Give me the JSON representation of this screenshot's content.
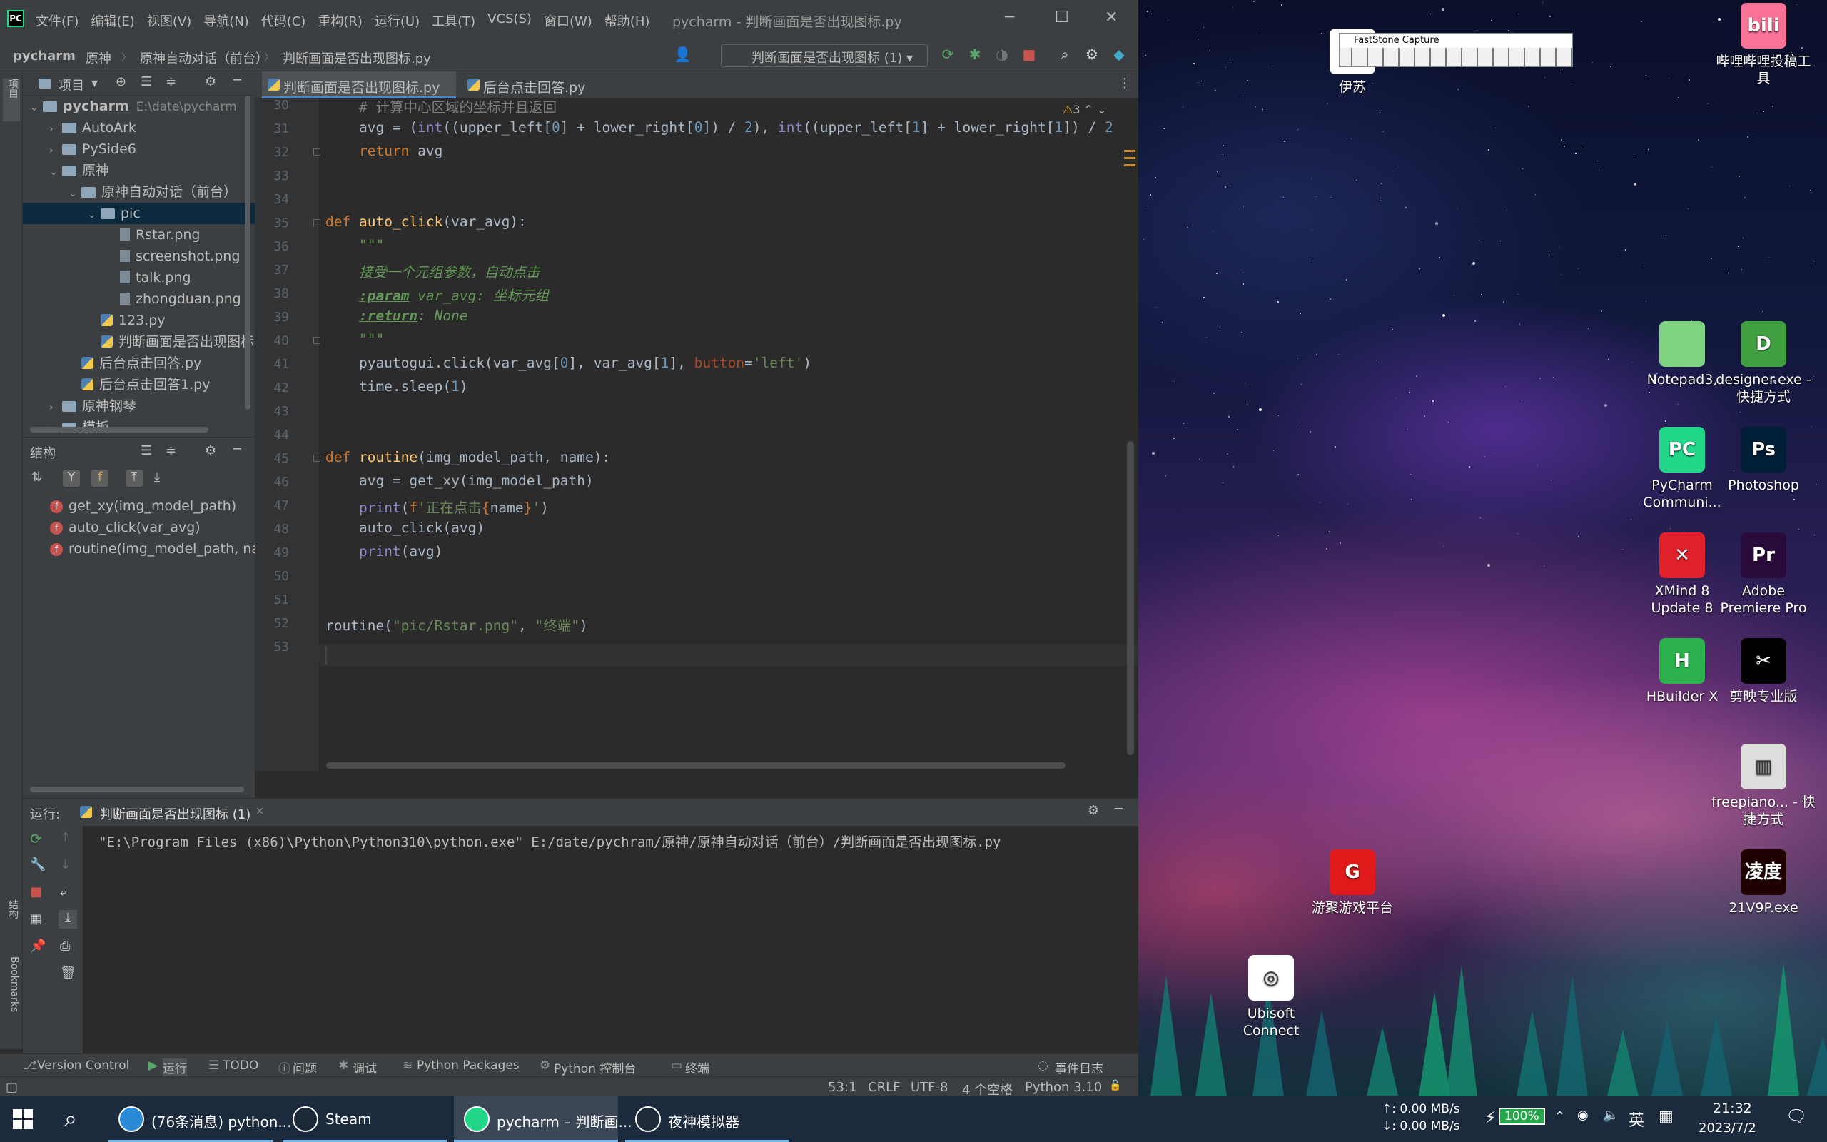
{
  "ide": {
    "menu": [
      "文件(F)",
      "编辑(E)",
      "视图(V)",
      "导航(N)",
      "代码(C)",
      "重构(R)",
      "运行(U)",
      "工具(T)",
      "VCS(S)",
      "窗口(W)",
      "帮助(H)"
    ],
    "window_title": "pycharm - 判断画面是否出现图标.py",
    "breadcrumbs": [
      "pycharm",
      "原神",
      "原神自动对话（前台）",
      "判断画面是否出现图标.py"
    ],
    "run_config": "判断画面是否出现图标 (1)",
    "project_label": "项目",
    "tree": [
      {
        "label": "pycharm",
        "extra": "E:\\date\\pycharm",
        "type": "folder",
        "depth": 0,
        "arrow": "down"
      },
      {
        "label": "AutoArk",
        "type": "folder",
        "depth": 1,
        "arrow": "right"
      },
      {
        "label": "PySide6",
        "type": "folder",
        "depth": 1,
        "arrow": "right"
      },
      {
        "label": "原神",
        "type": "folder",
        "depth": 1,
        "arrow": "down"
      },
      {
        "label": "原神自动对话（前台）",
        "type": "folder",
        "depth": 2,
        "arrow": "down"
      },
      {
        "label": "pic",
        "type": "folder",
        "depth": 3,
        "arrow": "down",
        "selected": true
      },
      {
        "label": "Rstar.png",
        "type": "png",
        "depth": 4
      },
      {
        "label": "screenshot.png",
        "type": "png",
        "depth": 4
      },
      {
        "label": "talk.png",
        "type": "png",
        "depth": 4
      },
      {
        "label": "zhongduan.png",
        "type": "png",
        "depth": 4
      },
      {
        "label": "123.py",
        "type": "py",
        "depth": 3
      },
      {
        "label": "判断画面是否出现图标",
        "type": "py",
        "depth": 3
      },
      {
        "label": "后台点击回答.py",
        "type": "py",
        "depth": 2
      },
      {
        "label": "后台点击回答1.py",
        "type": "py",
        "depth": 2
      },
      {
        "label": "原神钢琴",
        "type": "folder",
        "depth": 1,
        "arrow": "right"
      },
      {
        "label": "模板",
        "type": "folder",
        "depth": 1,
        "arrow": "right"
      }
    ],
    "structure_label": "结构",
    "structure_items": [
      "get_xy(img_model_path)",
      "auto_click(var_avg)",
      "routine(img_model_path, nam"
    ],
    "tabs": [
      "判断画面是否出现图标.py",
      "后台点击回答.py"
    ],
    "warnings": "3",
    "code_lines": [
      {
        "n": "30",
        "html": "    <span class='cmt'># 计算中心区域的坐标并且返回</span>"
      },
      {
        "n": "31",
        "html": "    avg = (<span class='bi'>int</span>((upper_left[<span class='num'>0</span>] + lower_right[<span class='num'>0</span>]) / <span class='num'>2</span>), <span class='bi'>int</span>((upper_left[<span class='num'>1</span>] + lower_right[<span class='num'>1</span>]) / <span class='num'>2</span>"
      },
      {
        "n": "32",
        "html": "    <span class='kw'>return</span> avg"
      },
      {
        "n": "33",
        "html": ""
      },
      {
        "n": "34",
        "html": ""
      },
      {
        "n": "35",
        "html": "<span class='kw'>def</span> <span class='fnc'>auto_click</span>(var_avg):"
      },
      {
        "n": "36",
        "html": "    <span class='doc'>\"\"\"</span>"
      },
      {
        "n": "37",
        "html": "    <span class='doc'>接受一个元组参数，自动点击</span>"
      },
      {
        "n": "38",
        "html": "    <span class='doc'><b><u>:param</u></b> var_avg: 坐标元组</span>"
      },
      {
        "n": "39",
        "html": "    <span class='doc'><b><u>:return</u></b>: None</span>"
      },
      {
        "n": "40",
        "html": "    <span class='doc'>\"\"\"</span>"
      },
      {
        "n": "41",
        "html": "    pyautogui.click(var_avg[<span class='num'>0</span>], var_avg[<span class='num'>1</span>], <span class='par'>button</span>=<span class='str'>'left'</span>)"
      },
      {
        "n": "42",
        "html": "    time.sleep(<span class='num'>1</span>)"
      },
      {
        "n": "43",
        "html": ""
      },
      {
        "n": "44",
        "html": ""
      },
      {
        "n": "45",
        "html": "<span class='kw'>def</span> <span class='fnc'>routine</span>(img_model_path, name):"
      },
      {
        "n": "46",
        "html": "    avg = get_xy(img_model_path)"
      },
      {
        "n": "47",
        "html": "    <span class='bi'>print</span>(<span class='kw'>f</span><span class='str'>'正在点击</span><span class='kw'>{</span>name<span class='kw'>}</span><span class='str'>'</span>)"
      },
      {
        "n": "48",
        "html": "    auto_click(avg)"
      },
      {
        "n": "49",
        "html": "    <span class='bi'>print</span>(avg)"
      },
      {
        "n": "50",
        "html": ""
      },
      {
        "n": "51",
        "html": ""
      },
      {
        "n": "52",
        "html": "routine(<span class='str'>\"pic/Rstar.png\"</span>, <span class='str'>\"终端\"</span>)"
      },
      {
        "n": "53",
        "html": ""
      }
    ],
    "run_label": "运行:",
    "run_tab": "判断画面是否出现图标 (1)",
    "console_line": "\"E:\\Program Files (x86)\\Python\\Python310\\python.exe\" E:/date/pychram/原神/原神自动对话（前台）/判断画面是否出现图标.py",
    "bottom_tools": [
      "Version Control",
      "运行",
      "TODO",
      "问题",
      "调试",
      "Python Packages",
      "Python 控制台",
      "终端"
    ],
    "event_log": "事件日志",
    "status": [
      "53:1",
      "CRLF",
      "UTF-8",
      "4 个空格",
      "Python 3.10"
    ],
    "side_labels": [
      "项目",
      "结构",
      "Bookmarks"
    ]
  },
  "fastcapture": {
    "title": "FastStone Capture"
  },
  "desktop_icons": [
    {
      "label": "哔哩哔哩投稿工具",
      "color": "#fb7299",
      "glyph": "bili"
    },
    {
      "label": "Notepad3,",
      "color": "#7fd27f",
      "glyph": ""
    },
    {
      "label": "designer.exe - 快捷方式",
      "color": "#40a040",
      "glyph": "D"
    },
    {
      "label": "PyCharm Communi...",
      "color": "#21d789",
      "glyph": "PC"
    },
    {
      "label": "Photoshop",
      "color": "#001e36",
      "glyph": "Ps"
    },
    {
      "label": "XMind 8 Update 8",
      "color": "#e0202a",
      "glyph": "✕"
    },
    {
      "label": "Adobe Premiere Pro",
      "color": "#2a0a3a",
      "glyph": "Pr"
    },
    {
      "label": "HBuilder X",
      "color": "#2bb24c",
      "glyph": "H"
    },
    {
      "label": "剪映专业版",
      "color": "#000000",
      "glyph": "✂"
    },
    {
      "label": "freepiano... - 快捷方式",
      "color": "#dddddd",
      "glyph": "▥"
    },
    {
      "label": "游聚游戏平台",
      "color": "#e01a1a",
      "glyph": "G"
    },
    {
      "label": "21V9P.exe",
      "color": "#200000",
      "glyph": "凌度"
    },
    {
      "label": "Ubisoft Connect",
      "color": "#ffffff",
      "glyph": "◎"
    },
    {
      "label": "伊苏",
      "color": "#ffffff",
      "glyph": ""
    }
  ],
  "taskbar": {
    "items": [
      "(76条消息) python...",
      "Steam",
      "pycharm – 判断画...",
      "夜神模拟器"
    ],
    "net_up": "↑: 0.00 MB/s",
    "net_down": "↓: 0.00 MB/s",
    "battery": "100%",
    "ime": "英",
    "time": "21:32",
    "date": "2023/7/2"
  }
}
